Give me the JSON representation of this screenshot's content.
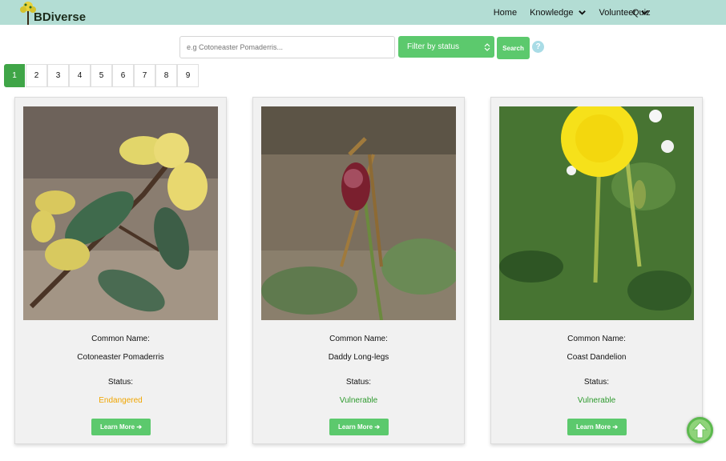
{
  "navbar": {
    "brand": "BDiverse",
    "items": [
      {
        "label": "Home",
        "dropdown": false
      },
      {
        "label": "Knowledge",
        "dropdown": true
      },
      {
        "label": "Volunteer",
        "dropdown": true
      }
    ],
    "quiz": "Quiz"
  },
  "search": {
    "placeholder": "e.g Cotoneaster Pomaderris...",
    "filter_label": "Filter by status",
    "button_label": "Search",
    "help_glyph": "?"
  },
  "pagination": {
    "pages": [
      "1",
      "2",
      "3",
      "4",
      "5",
      "6",
      "7",
      "8",
      "9"
    ],
    "active": "1"
  },
  "cards": [
    {
      "name_label": "Common Name:",
      "name": "Cotoneaster Pomaderris",
      "status_label": "Status:",
      "status": "Endangered",
      "status_color": "#f0a500",
      "button": "Learn More ➔"
    },
    {
      "name_label": "Common Name:",
      "name": "Daddy Long-legs",
      "status_label": "Status:",
      "status": "Vulnerable",
      "status_color": "#2e9a2e",
      "button": "Learn More ➔"
    },
    {
      "name_label": "Common Name:",
      "name": "Coast Dandelion",
      "status_label": "Status:",
      "status": "Vulnerable",
      "status_color": "#2e9a2e",
      "button": "Learn More ➔"
    }
  ],
  "colors": {
    "nav_bg": "#b3ddd4",
    "accent": "#5cc96d",
    "active_page": "#3fa547"
  },
  "icons": {
    "logo": "tree-logo-icon",
    "dropdown": "chevron-down-icon",
    "help": "help-icon",
    "scroll": "arrow-up-icon"
  }
}
